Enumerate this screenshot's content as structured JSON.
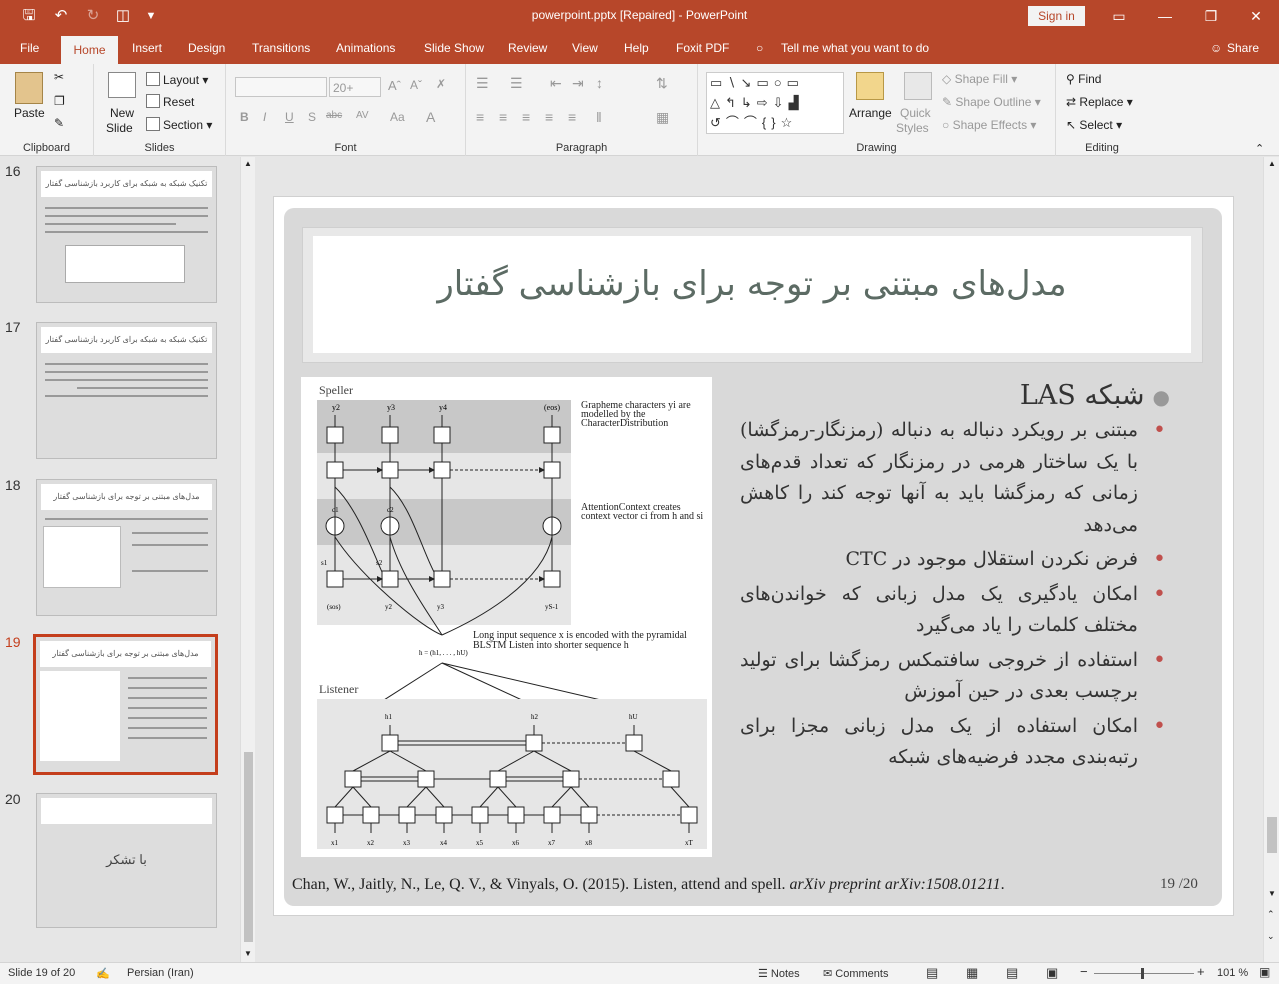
{
  "window": {
    "title": "powerpoint.pptx [Repaired]  -  PowerPoint",
    "signin": "Sign in"
  },
  "tabs": [
    "File",
    "Home",
    "Insert",
    "Design",
    "Transitions",
    "Animations",
    "Slide Show",
    "Review",
    "View",
    "Help",
    "Foxit PDF",
    "Tell me what you want to do",
    "Share"
  ],
  "ribbon": {
    "clipboard": {
      "label": "Clipboard",
      "paste": "Paste"
    },
    "slides": {
      "label": "Slides",
      "new_slide": "New",
      "new_slide2": "Slide",
      "layout": "Layout",
      "reset": "Reset",
      "section": "Section"
    },
    "font": {
      "label": "Font",
      "size": "20+",
      "buttons": [
        "B",
        "I",
        "U",
        "S",
        "abc",
        "AV",
        "Aa",
        "A"
      ]
    },
    "paragraph": {
      "label": "Paragraph"
    },
    "drawing": {
      "label": "Drawing",
      "arrange": "Arrange",
      "quick_styles": "Quick",
      "quick_styles2": "Styles",
      "shape_fill": "Shape Fill",
      "shape_outline": "Shape Outline",
      "shape_effects": "Shape Effects"
    },
    "editing": {
      "label": "Editing",
      "find": "Find",
      "replace": "Replace",
      "select": "Select"
    }
  },
  "thumbnails": [
    {
      "num": "16",
      "title": "تکنیک شبکه به شبکه برای کاربرد بازشناسی گفتار"
    },
    {
      "num": "17",
      "title": "تکنیک شبکه به شبکه برای کاربرد بازشناسی گفتار"
    },
    {
      "num": "18",
      "title": "مدل‌های مبتنی بر توجه برای بازشناسی گفتار"
    },
    {
      "num": "19",
      "title": "مدل‌های مبتنی بر توجه برای بازشناسی گفتار"
    },
    {
      "num": "20",
      "title": "با تشکر"
    }
  ],
  "slide": {
    "title": "مدل‌های مبتنی بر توجه برای بازشناسی گفتار",
    "heading": "شبکه LAS",
    "bullets": [
      "مبتنی بر رویکرد دنباله به دنباله (رمزنگار-رمزگشا) با یک ساختار هرمی در رمزنگار که تعداد قدم‌های زمانی که رمزگشا باید به آنها توجه کند را کاهش می‌دهد",
      "فرض نکردن استقلال موجود در CTC",
      "امکان یادگیری یک مدل زبانی که خواندن‌های مختلف کلمات را یاد می‌گیرد",
      "استفاده از خروجی سافتمکس رمزگشا برای تولید برچسب بعدی در حین آموزش",
      "امکان استفاده از یک مدل زبانی مجزا برای رتبه‌بندی مجدد فرضیه‌های شبکه"
    ],
    "citation": "Chan, W., Jaitly, N., Le, Q. V., & Vinyals, O. (2015). Listen, attend and spell.",
    "citation_italic": "arXiv preprint arXiv:1508.01211",
    "citation_end": ".",
    "page": "19 /20",
    "figure": {
      "speller": "Speller",
      "listener": "Listener",
      "grapheme": "Grapheme characters yi are modelled by the CharacterDistribution",
      "attention": "AttentionContext creates context vector ci from h and si",
      "input": "Long input sequence x is encoded with the pyramidal BLSTM Listen into shorter sequence h",
      "h_eq": "h = (h1, . . . , hU)",
      "top_labels": [
        "y2",
        "y3",
        "y4",
        "(eos)"
      ],
      "bottom_labels": [
        "(sos)",
        "y2",
        "y3",
        "yS-1"
      ],
      "c_labels": [
        "c1",
        "c2"
      ],
      "s_labels": [
        "s1",
        "s2"
      ],
      "h_top": [
        "h1",
        "h2",
        "hU"
      ],
      "x_labels": [
        "x1",
        "x2",
        "x3",
        "x4",
        "x5",
        "x6",
        "x7",
        "x8",
        "xT"
      ]
    }
  },
  "status": {
    "slide": "Slide 19 of 20",
    "lang": "Persian (Iran)",
    "notes": "Notes",
    "comments": "Comments",
    "zoom": "101 %"
  }
}
